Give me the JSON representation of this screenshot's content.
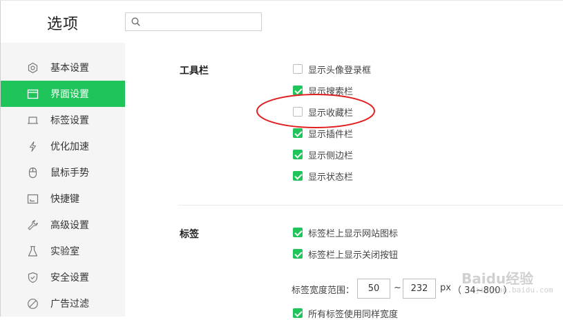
{
  "window": {
    "title": "选项"
  },
  "search": {
    "placeholder": ""
  },
  "sidebar": {
    "items": [
      {
        "label": "基本设置",
        "icon": "gear-icon",
        "active": false
      },
      {
        "label": "界面设置",
        "icon": "window-icon",
        "active": true
      },
      {
        "label": "标签设置",
        "icon": "tab-icon",
        "active": false
      },
      {
        "label": "优化加速",
        "icon": "lightning-icon",
        "active": false
      },
      {
        "label": "鼠标手势",
        "icon": "mouse-icon",
        "active": false
      },
      {
        "label": "快捷键",
        "icon": "keyboard-icon",
        "active": false
      },
      {
        "label": "高级设置",
        "icon": "wrench-icon",
        "active": false
      },
      {
        "label": "实验室",
        "icon": "flask-icon",
        "active": false
      },
      {
        "label": "安全设置",
        "icon": "shield-icon",
        "active": false
      },
      {
        "label": "广告过滤",
        "icon": "ban-icon",
        "active": false
      }
    ]
  },
  "toolbar_section": {
    "title": "工具栏",
    "options": [
      {
        "label": "显示头像登录框",
        "checked": false
      },
      {
        "label": "显示搜索栏",
        "checked": true
      },
      {
        "label": "显示收藏栏",
        "checked": false
      },
      {
        "label": "显示插件栏",
        "checked": true
      },
      {
        "label": "显示侧边栏",
        "checked": true
      },
      {
        "label": "显示状态栏",
        "checked": true
      }
    ]
  },
  "tabs_section": {
    "title": "标签",
    "options": [
      {
        "label": "标签栏上显示网站图标",
        "checked": true
      },
      {
        "label": "标签栏上显示关闭按钮",
        "checked": true
      }
    ],
    "width_range": {
      "label": "标签宽度范围：",
      "min": "50",
      "separator": "~",
      "max": "232",
      "unit": "px",
      "hint": "（ 34~800 ）"
    },
    "same_width": {
      "label": "所有标签使用同样宽度",
      "checked": true
    }
  },
  "watermark": {
    "text": "Baidu经验",
    "sub": "jingyan.baidu.com"
  },
  "colors": {
    "accent": "#1fc55a",
    "annotation": "#e02020",
    "sidebar_bg": "#f5f5f5"
  }
}
